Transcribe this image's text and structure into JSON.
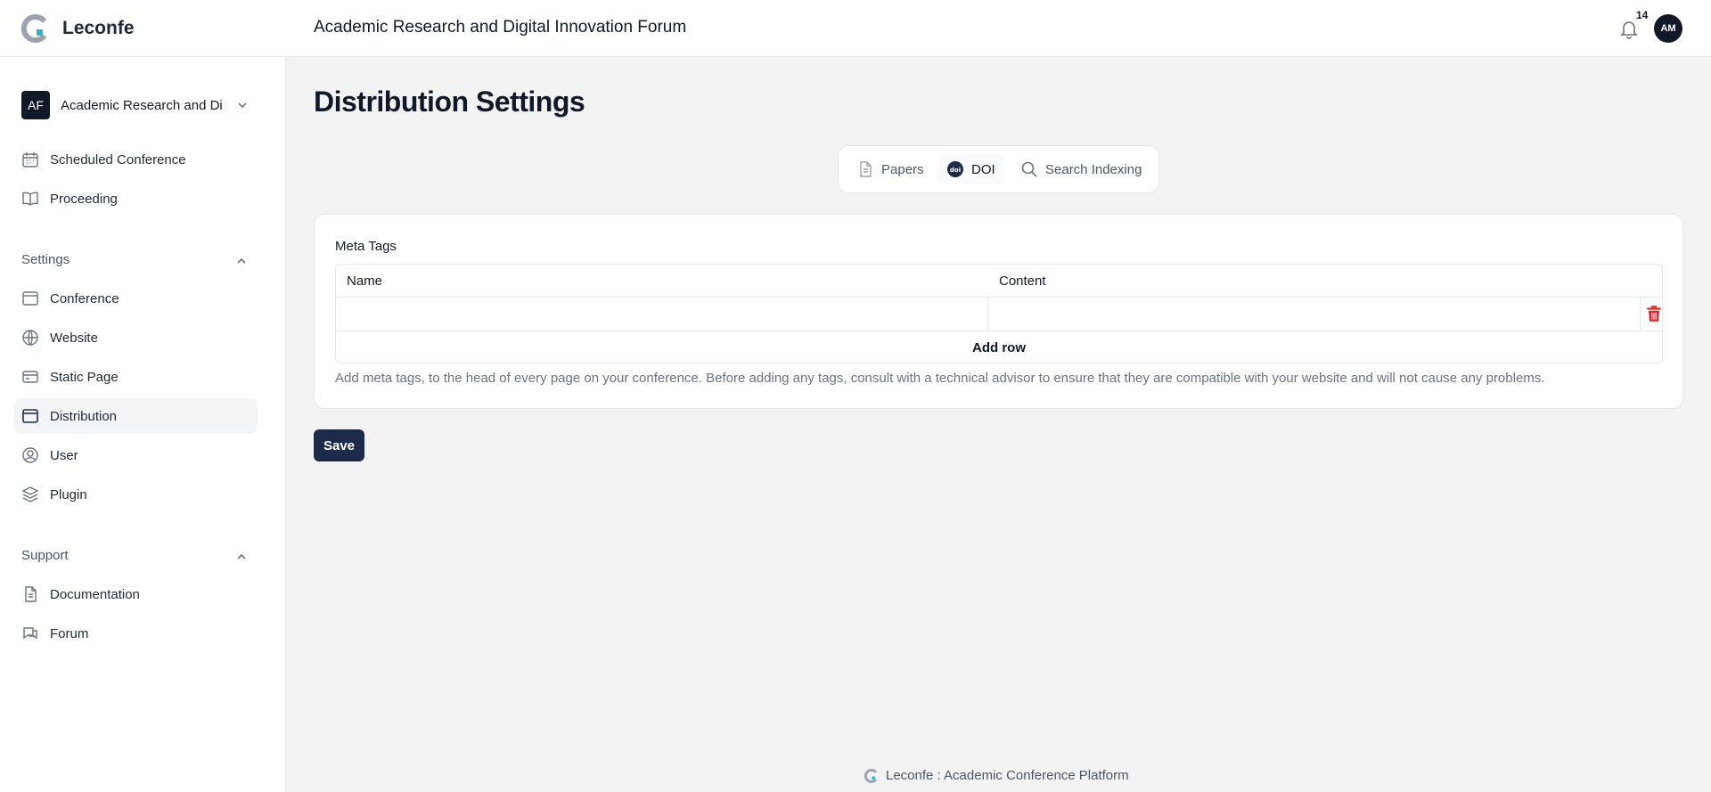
{
  "header": {
    "brand_name": "Leconfe",
    "title": "Academic Research and Digital Innovation Forum",
    "notification_count": "14",
    "avatar_initials": "AM"
  },
  "sidebar": {
    "conference": {
      "initials": "AF",
      "name": "Academic Research and Digital Innovation Forum"
    },
    "top_items": [
      {
        "label": "Scheduled Conference",
        "icon": "calendar-icon"
      },
      {
        "label": "Proceeding",
        "icon": "book-icon"
      }
    ],
    "settings_label": "Settings",
    "settings_items": [
      {
        "label": "Conference",
        "icon": "window-icon"
      },
      {
        "label": "Website",
        "icon": "globe-icon"
      },
      {
        "label": "Static Page",
        "icon": "credit-card-icon"
      },
      {
        "label": "Distribution",
        "icon": "window-icon",
        "active": true
      },
      {
        "label": "User",
        "icon": "user-circle-icon"
      },
      {
        "label": "Plugin",
        "icon": "layers-icon"
      }
    ],
    "support_label": "Support",
    "support_items": [
      {
        "label": "Documentation",
        "icon": "document-icon"
      },
      {
        "label": "Forum",
        "icon": "chat-icon"
      }
    ]
  },
  "main": {
    "page_title": "Distribution Settings",
    "tabs": [
      {
        "label": "Papers",
        "icon": "document-icon"
      },
      {
        "label": "DOI",
        "icon": "doi-icon",
        "active": true
      },
      {
        "label": "Search Indexing",
        "icon": "search-icon"
      }
    ],
    "meta_tags": {
      "label": "Meta Tags",
      "columns": [
        "Name",
        "Content"
      ],
      "rows": [
        {
          "name": "",
          "content": ""
        }
      ],
      "add_row_label": "Add row",
      "help_text": "Add meta tags, to the head of every page on your conference. Before adding any tags, consult with a technical advisor to ensure that they are compatible with your website and will not cause any problems."
    },
    "save_label": "Save"
  },
  "footer": {
    "text": "Leconfe : Academic Conference Platform"
  },
  "colors": {
    "primary": "#1e2a4a",
    "danger": "#dc2626",
    "accent": "#22b8d8"
  }
}
